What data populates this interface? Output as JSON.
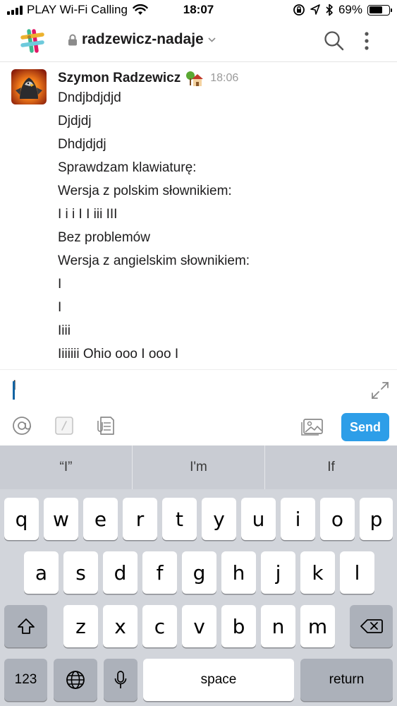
{
  "status_bar": {
    "carrier": "PLAY Wi-Fi Calling",
    "time": "18:07",
    "battery_percent": "69%",
    "battery_level": 0.69
  },
  "header": {
    "channel_name": "radzewicz-nadaje"
  },
  "message": {
    "author": "Szymon Radzewicz",
    "time": "18:06",
    "lines": [
      "Dndjbdjdjd",
      "Djdjdj",
      "Dhdjdjdj",
      "Sprawdzam klawiaturę:",
      "Wersja z polskim słownikiem:",
      "I i i I I iii III",
      "Bez problemów",
      "Wersja z angielskim słownikiem:",
      "I",
      "I",
      "Iiii",
      "Iiiiiii Ohio ooo I ooo I"
    ]
  },
  "composer": {
    "input_value": "I",
    "send_label": "Send"
  },
  "keyboard": {
    "predictions": [
      "“I”",
      "I'm",
      "If"
    ],
    "row1": [
      "q",
      "w",
      "e",
      "r",
      "t",
      "y",
      "u",
      "i",
      "o",
      "p"
    ],
    "row2": [
      "a",
      "s",
      "d",
      "f",
      "g",
      "h",
      "j",
      "k",
      "l"
    ],
    "row3": [
      "z",
      "x",
      "c",
      "v",
      "b",
      "n",
      "m"
    ],
    "numbers_label": "123",
    "space_label": "space",
    "return_label": "return"
  },
  "colors": {
    "accent": "#2d9ee8",
    "text": "#1d1c1d",
    "keyboard_bg": "#d2d5db"
  }
}
